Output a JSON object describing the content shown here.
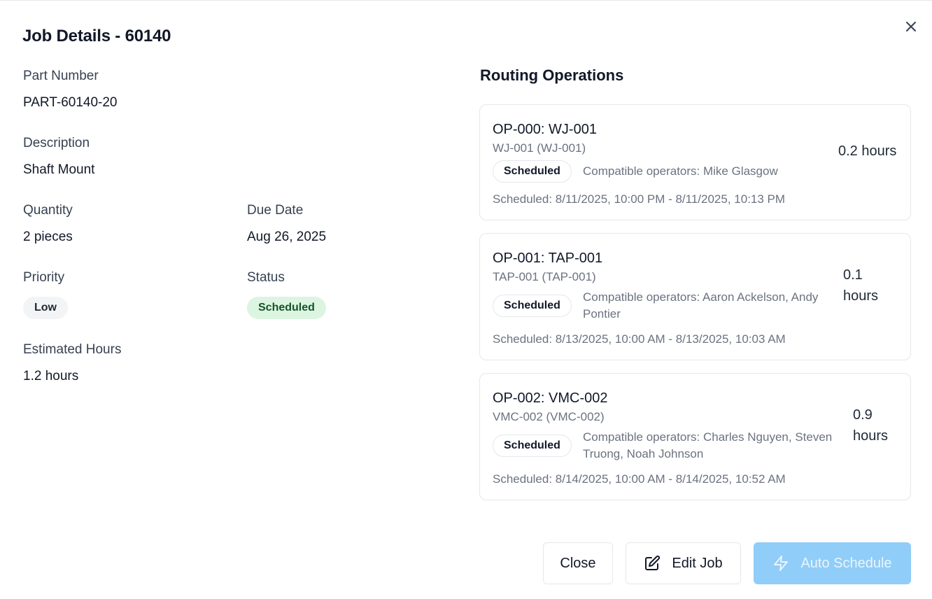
{
  "dialog": {
    "title": "Job Details - 60140",
    "close_icon": "close-icon"
  },
  "fields": {
    "part_number": {
      "label": "Part Number",
      "value": "PART-60140-20"
    },
    "description": {
      "label": "Description",
      "value": "Shaft Mount"
    },
    "quantity": {
      "label": "Quantity",
      "value": "2 pieces"
    },
    "due_date": {
      "label": "Due Date",
      "value": "Aug 26, 2025"
    },
    "priority": {
      "label": "Priority",
      "value": "Low"
    },
    "status": {
      "label": "Status",
      "value": "Scheduled"
    },
    "estimated_hours": {
      "label": "Estimated Hours",
      "value": "1.2 hours"
    }
  },
  "routing": {
    "title": "Routing Operations",
    "operations": [
      {
        "title": "OP-000: WJ-001",
        "sub": "WJ-001 (WJ-001)",
        "badge": "Scheduled",
        "operators": "Compatible operators: Mike Glasgow",
        "scheduled": "Scheduled: 8/11/2025, 10:00 PM - 8/11/2025, 10:13 PM",
        "hours": "0.2 hours"
      },
      {
        "title": "OP-001: TAP-001",
        "sub": "TAP-001 (TAP-001)",
        "badge": "Scheduled",
        "operators": "Compatible operators: Aaron Ackelson, Andy Pontier",
        "scheduled": "Scheduled: 8/13/2025, 10:00 AM - 8/13/2025, 10:03 AM",
        "hours": "0.1 hours"
      },
      {
        "title": "OP-002: VMC-002",
        "sub": "VMC-002 (VMC-002)",
        "badge": "Scheduled",
        "operators": "Compatible operators: Charles Nguyen, Steven Truong, Noah Johnson",
        "scheduled": "Scheduled: 8/14/2025, 10:00 AM - 8/14/2025, 10:52 AM",
        "hours": "0.9 hours"
      }
    ]
  },
  "footer": {
    "close_label": "Close",
    "edit_label": "Edit Job",
    "edit_icon": "edit-icon",
    "auto_schedule_label": "Auto Schedule",
    "auto_schedule_icon": "lightning-icon"
  },
  "colors": {
    "primary_button": "#90cdf8",
    "scheduled_badge": "#dcf5e0",
    "low_badge": "#f3f4f6"
  }
}
